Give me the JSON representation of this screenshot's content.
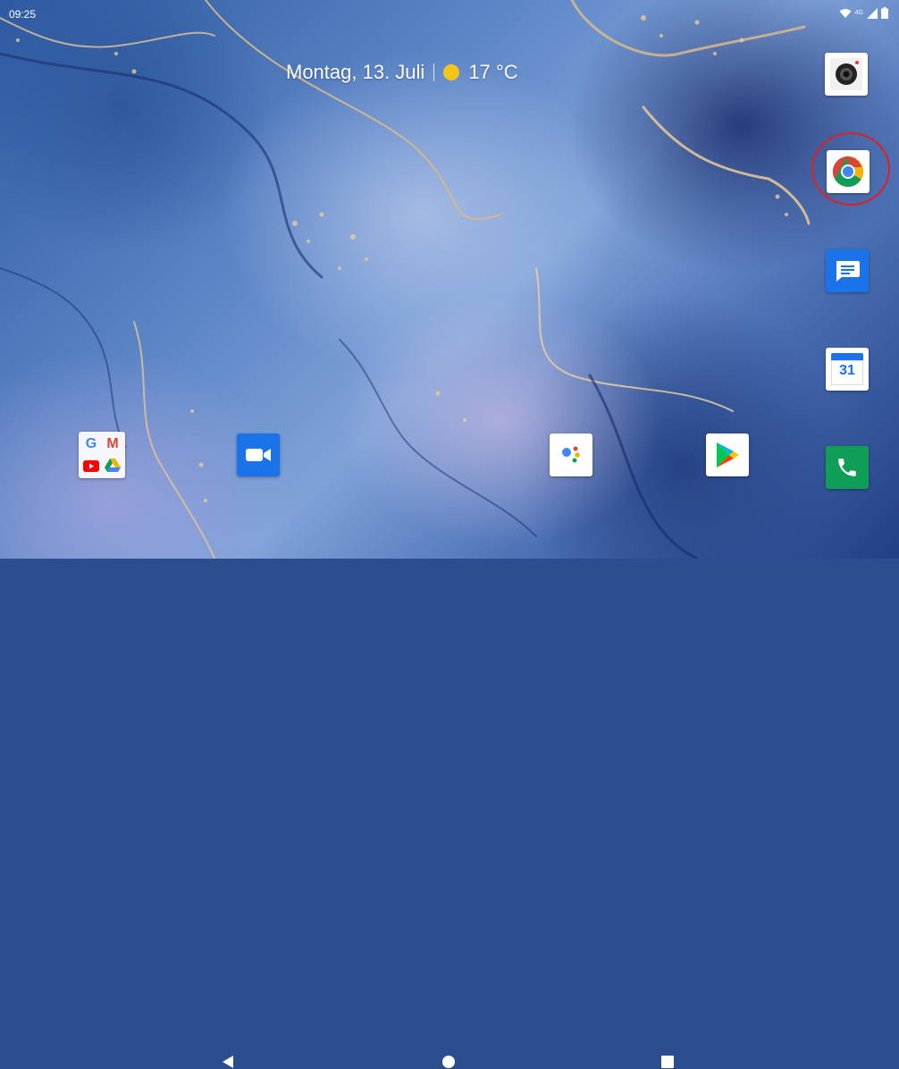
{
  "status_bar": {
    "time": "09:25",
    "icons": [
      "wifi-icon",
      "signal-icon",
      "battery-icon"
    ],
    "network_label": "4G"
  },
  "date_widget": {
    "date": "Montag, 13. Juli",
    "weather_icon": "sun-icon",
    "temperature": "17 °C"
  },
  "dock_right": [
    {
      "name": "camera-app-icon"
    },
    {
      "name": "chrome-app-icon",
      "highlighted": true
    },
    {
      "name": "messages-app-icon"
    },
    {
      "name": "calendar-app-icon",
      "day": "31"
    },
    {
      "name": "phone-app-icon"
    }
  ],
  "bottom_row": [
    {
      "name": "google-folder-icon"
    },
    {
      "name": "duo-app-icon"
    },
    {
      "name": "assistant-app-icon"
    },
    {
      "name": "play-store-app-icon"
    }
  ],
  "colors": {
    "highlight_ring": "#e02020",
    "messages_blue": "#1a73e8",
    "phone_green": "#0f9d58",
    "duo_blue": "#1a73e8"
  }
}
